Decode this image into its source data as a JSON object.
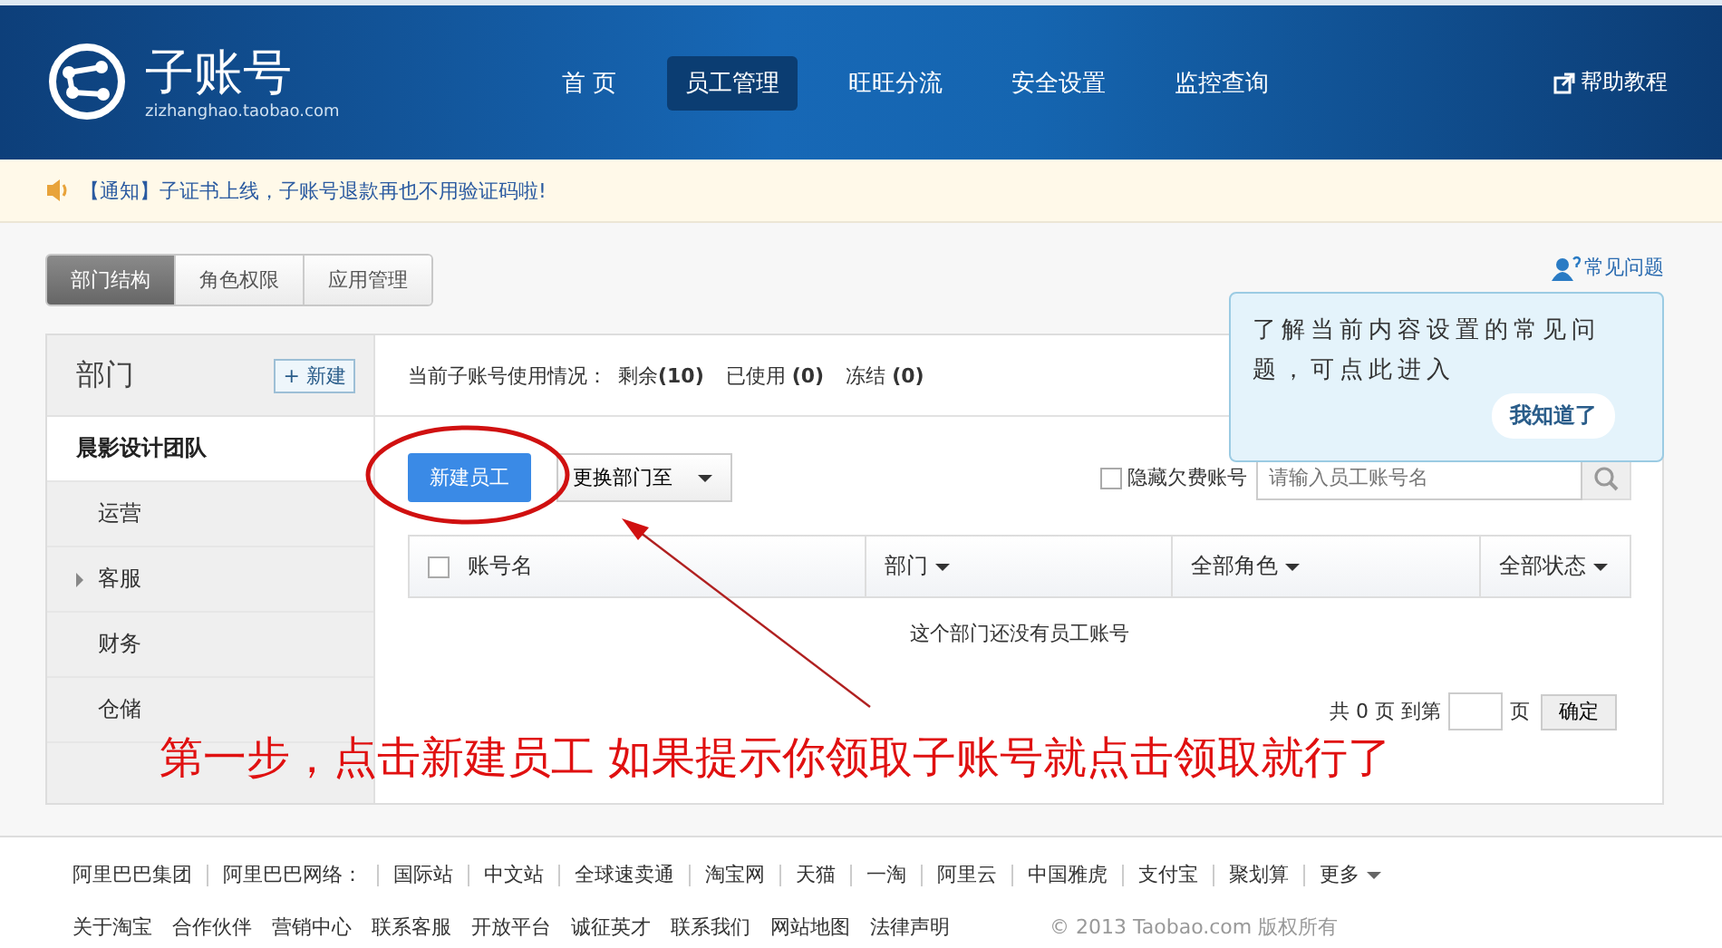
{
  "header": {
    "logo_title": "子账号",
    "logo_subtitle": "zizhanghao.taobao.com",
    "nav": [
      {
        "label": "首 页",
        "selected": false
      },
      {
        "label": "员工管理",
        "selected": true
      },
      {
        "label": "旺旺分流",
        "selected": false
      },
      {
        "label": "安全设置",
        "selected": false
      },
      {
        "label": "监控查询",
        "selected": false
      }
    ],
    "help_link": "帮助教程"
  },
  "notice": {
    "tag": "【通知】",
    "text": "子证书上线，子账号退款再也不用验证码啦!"
  },
  "tabs": [
    {
      "label": "部门结构",
      "selected": true
    },
    {
      "label": "角色权限",
      "selected": false
    },
    {
      "label": "应用管理",
      "selected": false
    }
  ],
  "faq_link": "常见问题",
  "tooltip": {
    "text": "了解当前内容设置的常见问题，可点此进入",
    "button": "我知道了"
  },
  "sidebar": {
    "title": "部门",
    "new_button": "+ 新建",
    "items": [
      {
        "label": "晨影设计团队",
        "selected": true,
        "children": [
          {
            "label": "运营",
            "selected": false,
            "collapsible": false
          },
          {
            "label": "客服",
            "selected": false,
            "collapsible": true
          },
          {
            "label": "财务",
            "selected": false,
            "collapsible": false
          },
          {
            "label": "仓储",
            "selected": false,
            "collapsible": false
          }
        ]
      }
    ]
  },
  "usage": {
    "label": "当前子账号使用情况：",
    "stats": [
      "剩余**(10)**",
      "已使用 **(0)**",
      "冻结 **(0)**"
    ]
  },
  "toolbar": {
    "new_button": "新建员工",
    "move_dropdown": "更换部门至",
    "hide_checkbox": {
      "label": "隐藏欠费账号",
      "checked": false
    },
    "search": {
      "placeholder": "请输入员工账号名"
    }
  },
  "table": {
    "columns": [
      {
        "label": "账号名",
        "kind": "checkbox",
        "checked": false
      },
      {
        "label": "部门",
        "kind": "dropdown"
      },
      {
        "label": "全部角色",
        "kind": "dropdown"
      },
      {
        "label": "全部状态",
        "kind": "dropdown"
      }
    ],
    "empty_message": "这个部门还没有员工账号"
  },
  "pagination": {
    "prefix": "共 0 页 到第",
    "suffix": "页",
    "confirm": "确定"
  },
  "annotation": {
    "text": "第一步，点击新建员工  如果提示你领取子账号就点击领取就行了"
  },
  "footer": {
    "group_links": [
      "阿里巴巴集团",
      "阿里巴巴网络：",
      "国际站",
      "中文站",
      "全球速卖通",
      "淘宝网",
      "天猫",
      "一淘",
      "阿里云",
      "中国雅虎",
      "支付宝",
      "聚划算",
      "更多"
    ],
    "site_links": [
      "关于淘宝",
      "合作伙伴",
      "营销中心",
      "联系客服",
      "开放平台",
      "诚征英才",
      "联系我们",
      "网站地图",
      "法律声明"
    ],
    "copyright": "© 2013 Taobao.com 版权所有"
  }
}
